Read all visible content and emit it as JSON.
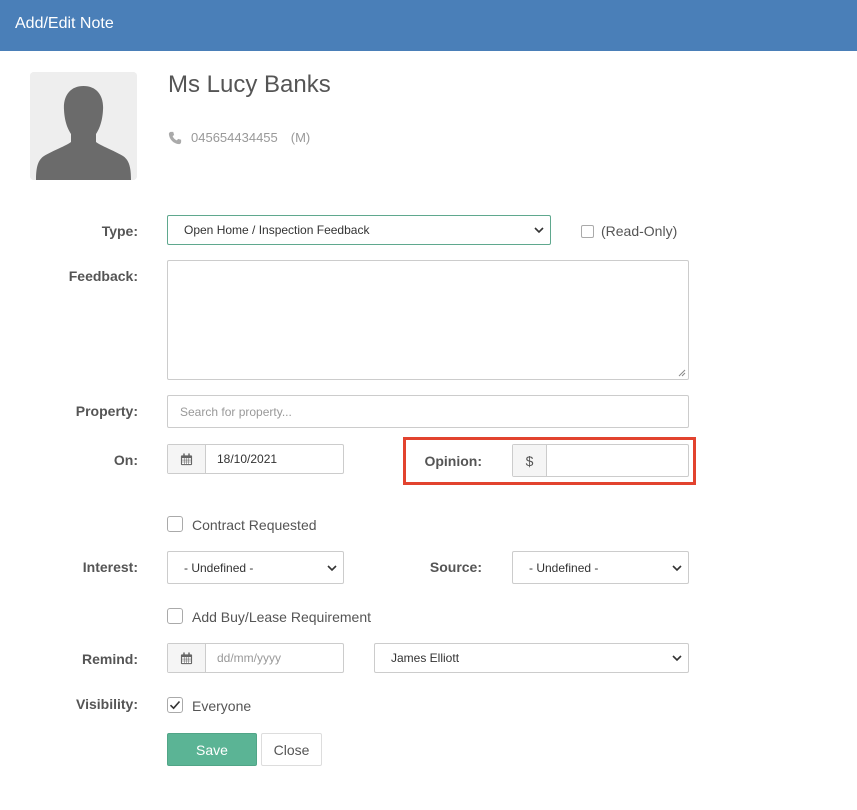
{
  "window": {
    "title": "Add/Edit Note",
    "header_color": "#4a7fb8"
  },
  "contact": {
    "name": "Ms Lucy Banks",
    "phone": "045654434455",
    "phone_type": "(M)",
    "phone_icon": "phone-icon",
    "avatar_icon": "person-silhouette-icon"
  },
  "form": {
    "type": {
      "label": "Type:",
      "value": "Open Home / Inspection Feedback"
    },
    "read_only": {
      "label": "(Read-Only)",
      "checked": false
    },
    "feedback": {
      "label": "Feedback:",
      "value": ""
    },
    "property": {
      "label": "Property:",
      "placeholder": "Search for property..."
    },
    "on": {
      "label": "On:",
      "date": "18/10/2021",
      "icon": "calendar-icon"
    },
    "opinion": {
      "label": "Opinion:",
      "currency": "$",
      "value": ""
    },
    "contract_requested": {
      "label": "Contract Requested",
      "checked": false
    },
    "interest": {
      "label": "Interest:",
      "value": "- Undefined -"
    },
    "source": {
      "label": "Source:",
      "value": "- Undefined -"
    },
    "buy_lease": {
      "label": "Add Buy/Lease Requirement",
      "checked": false
    },
    "remind": {
      "label": "Remind:",
      "placeholder": "dd/mm/yyyy",
      "icon": "calendar-icon",
      "user": "James Elliott"
    },
    "visibility": {
      "label": "Visibility:",
      "option": "Everyone",
      "checked": true
    }
  },
  "buttons": {
    "save": "Save",
    "close": "Close",
    "save_color": "#5bb495"
  },
  "highlight_color": "#e2432f"
}
